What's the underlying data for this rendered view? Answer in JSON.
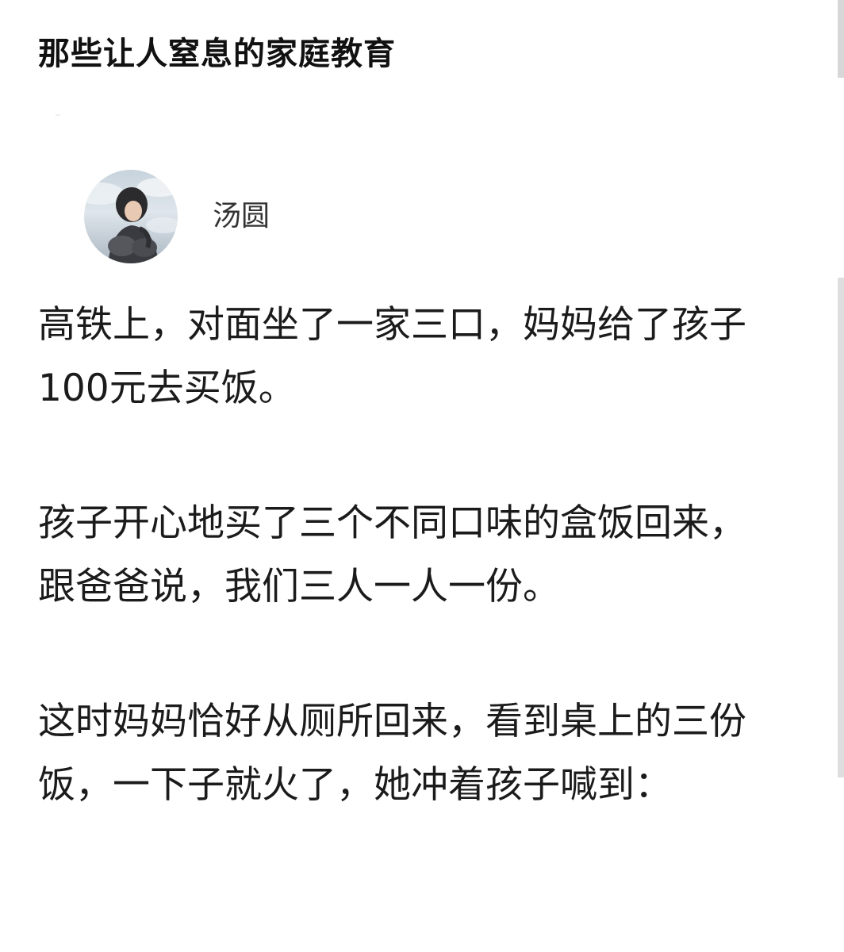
{
  "page": {
    "title": "那些让人窒息的家庭教育"
  },
  "author": {
    "name": "汤圆",
    "avatar_icon": "user-avatar-photo"
  },
  "article": {
    "paragraphs": [
      "高铁上，对面坐了一家三口，妈妈给了孩子100元去买饭。",
      "孩子开心地买了三个不同口味的盒饭回来，跟爸爸说，我们三人一人一份。",
      "这时妈妈恰好从厕所回来，看到桌上的三份饭，一下子就火了，她冲着孩子喊到："
    ]
  },
  "colors": {
    "title": "#111111",
    "body_text": "#1b1b1b",
    "author_name": "#333333",
    "scrollbar": "#dedede"
  }
}
